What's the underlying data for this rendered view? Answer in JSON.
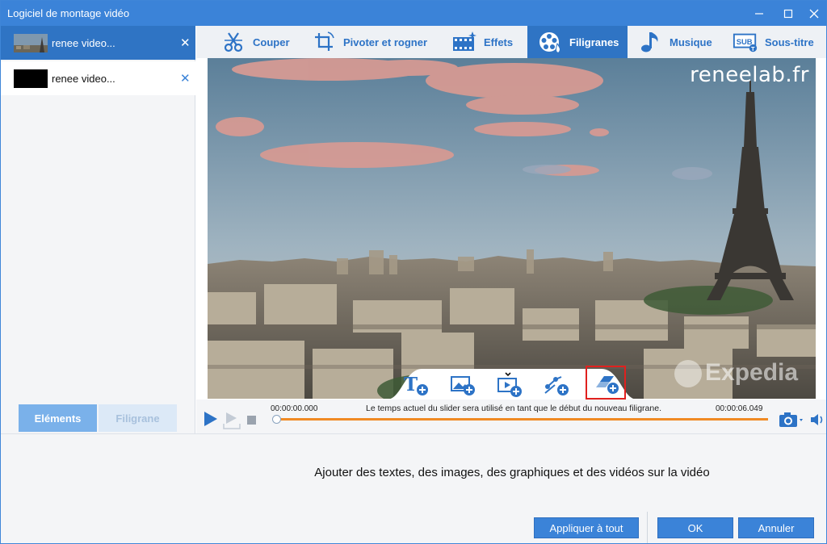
{
  "window": {
    "title": "Logiciel de montage vidéo"
  },
  "files": [
    {
      "name": "renee video...",
      "selected": true
    },
    {
      "name": "renee video...",
      "selected": false
    }
  ],
  "left_tabs": {
    "elements": "Eléments",
    "watermark": "Filigrane"
  },
  "tabs": [
    {
      "label": "Couper",
      "icon": "scissors-icon"
    },
    {
      "label": "Pivoter et rogner",
      "icon": "crop-rotate-icon"
    },
    {
      "label": "Effets",
      "icon": "film-effects-icon"
    },
    {
      "label": "Filigranes",
      "icon": "watermark-reel-icon",
      "active": true
    },
    {
      "label": "Musique",
      "icon": "music-note-icon"
    },
    {
      "label": "Sous-titre",
      "icon": "subtitle-icon"
    }
  ],
  "video": {
    "watermark_text": "reneelab.fr",
    "logo_text": "Expedia"
  },
  "timeline": {
    "start_time": "00:00:00.000",
    "end_time": "00:00:06.049",
    "note": "Le temps actuel du slider sera utilisé en tant que le début du nouveau filigrane.",
    "position": 0
  },
  "bottom": {
    "hint": "Ajouter des textes, des images, des graphiques et des vidéos sur la vidéo",
    "apply_all": "Appliquer à tout",
    "ok": "OK",
    "cancel": "Annuler"
  },
  "colors": {
    "accent": "#3b83d8",
    "active_tab": "#2f74c4",
    "progress": "#f08a24",
    "highlight": "#e0201e"
  }
}
